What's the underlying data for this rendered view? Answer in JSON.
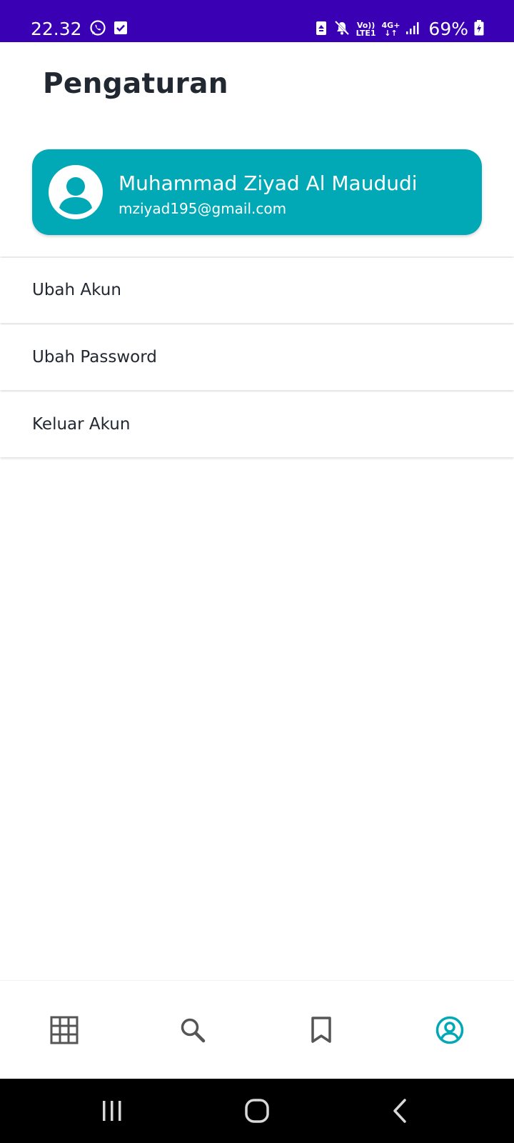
{
  "status_bar": {
    "time": "22.32",
    "icons_left": [
      "whatsapp-icon",
      "check-box-icon"
    ],
    "icons_right": [
      "data-saver-icon",
      "mute-icon",
      "volte-icon",
      "network-4g-icon",
      "signal-icon"
    ],
    "volte_top": "Vo))",
    "volte_bottom": "LTE1",
    "network_top": "4G+",
    "network_bottom": "↓↑",
    "battery_percent": "69%",
    "background_color": "#3a00b4"
  },
  "app_bar": {
    "title": "Pengaturan"
  },
  "profile": {
    "name": "Muhammad Ziyad Al Maududi",
    "email": "mziyad195@gmail.com",
    "avatar_icon": "user-avatar-icon",
    "card_color": "#00a9b5"
  },
  "menu": {
    "items": [
      {
        "label": "Ubah Akun"
      },
      {
        "label": "Ubah Password"
      },
      {
        "label": "Keluar Akun"
      }
    ]
  },
  "bottom_nav": {
    "items": [
      {
        "icon": "grid-icon",
        "active": false
      },
      {
        "icon": "search-icon",
        "active": false
      },
      {
        "icon": "bookmark-icon",
        "active": false
      },
      {
        "icon": "account-circle-icon",
        "active": true
      }
    ],
    "active_color": "#00a9b5",
    "inactive_color": "#555555"
  },
  "system_nav": {
    "buttons": [
      "recent-apps-icon",
      "home-icon",
      "back-icon"
    ]
  }
}
